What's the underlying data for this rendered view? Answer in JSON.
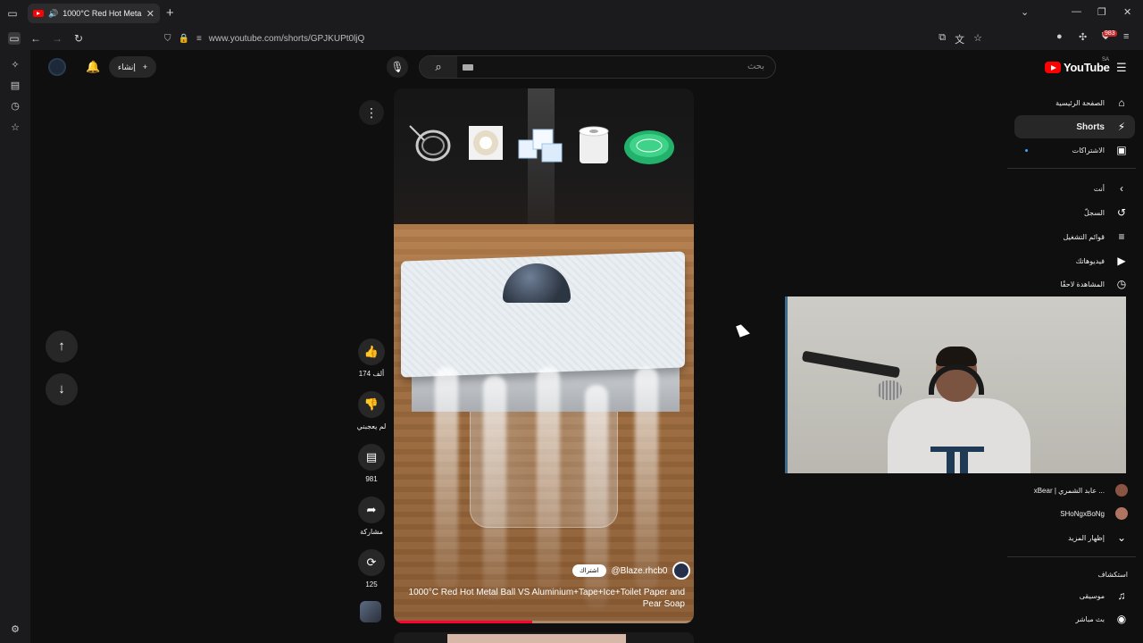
{
  "browser": {
    "tab_title": "1000°C Red Hot Metal Ball",
    "url": "www.youtube.com/shorts/GPJKUPt0ljQ",
    "ext_badge": "983"
  },
  "header": {
    "logo_text": "YouTube",
    "region": "SA",
    "search_placeholder": "بحث",
    "create_label": "إنشاء"
  },
  "short": {
    "channel": "@Blaze.rhcb0",
    "subscribe_label": "اشتراك",
    "title": "1000°C Red Hot Metal Ball VS Aluminium+Tape+Ice+Toilet Paper and Pear Soap",
    "progress": 0.46
  },
  "actions": {
    "likes": "174 ألف",
    "dislike_label": "لم يعجبني",
    "comments": "981",
    "share_label": "مشاركة",
    "remix": "125"
  },
  "sidebar": {
    "home": "الصفحة الرئيسية",
    "shorts": "Shorts",
    "subscriptions": "الاشتراكات",
    "you": "أنت",
    "history": "السجلّ",
    "playlists": "قوائم التشغيل",
    "your_videos": "فيديوهاتك",
    "watch_later": "المشاهدة لاحقًا",
    "sub1": "xBear | عابد الشمري ...",
    "sub2": "SHoNgxBoNg",
    "show_more": "إظهار المزيد",
    "explore": "استكشاف",
    "music": "موسيقى",
    "live": "بث مباشر"
  },
  "colors": {
    "brand_red": "#ff0000",
    "progress_red": "#ff0033",
    "background": "#0f0f0f"
  }
}
